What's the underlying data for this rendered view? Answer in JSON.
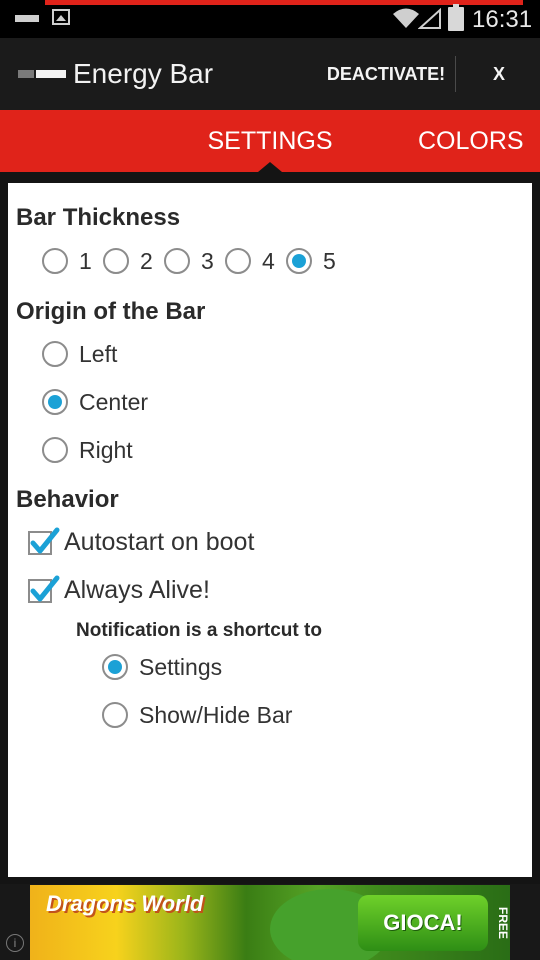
{
  "status_bar": {
    "time": "16:31",
    "icons": [
      "battery-saver-icon",
      "picture-icon",
      "wifi-icon",
      "cell-signal-icon",
      "battery-icon"
    ],
    "progress_color": "#e0231a"
  },
  "action_bar": {
    "title": "Energy Bar",
    "deactivate_label": "DEACTIVATE!",
    "close_label": "X"
  },
  "tabs": [
    {
      "label": "SETTINGS",
      "selected": true
    },
    {
      "label": "COLORS",
      "selected": false
    }
  ],
  "settings": {
    "bar_thickness": {
      "heading": "Bar Thickness",
      "options": [
        "1",
        "2",
        "3",
        "4",
        "5"
      ],
      "selected": "5"
    },
    "origin": {
      "heading": "Origin of the Bar",
      "options": [
        "Left",
        "Center",
        "Right"
      ],
      "selected": "Center"
    },
    "behavior": {
      "heading": "Behavior",
      "autostart_label": "Autostart on boot",
      "autostart_checked": true,
      "always_alive_label": "Always Alive!",
      "always_alive_checked": true,
      "notification_heading": "Notification is a shortcut to",
      "notification_options": [
        "Settings",
        "Show/Hide Bar"
      ],
      "notification_selected": "Settings"
    }
  },
  "ad": {
    "brand": "Dragons World",
    "cta": "GIOCA!",
    "badge": "FREE"
  },
  "colors": {
    "accent_red": "#e0231a",
    "radio_blue": "#1ba1d6",
    "action_bar": "#1b1b1b"
  }
}
